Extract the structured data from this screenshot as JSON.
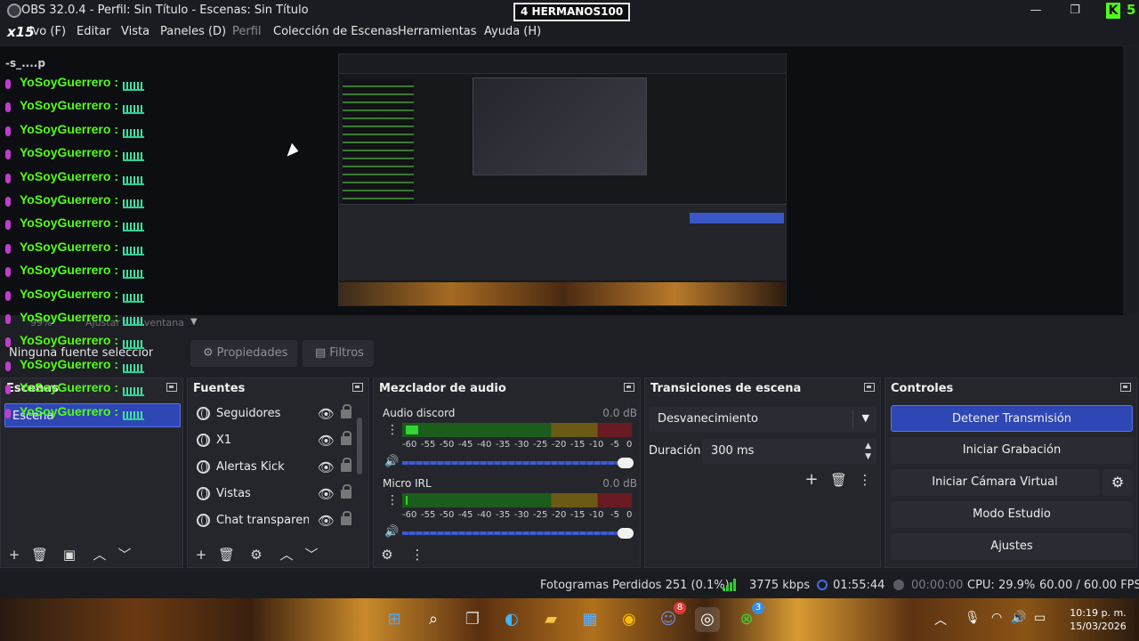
{
  "titlebar": {
    "title": "OBS 32.0.4 - Perfil: Sin Título - Escenas: Sin Título",
    "overlay_banner": "4  HERMANOS100",
    "minimize": "—",
    "maximize": "❐",
    "close": "✕",
    "kick_letter": "K",
    "kick_count": "5"
  },
  "menu": {
    "logo_text": "x15",
    "items": [
      {
        "label": "Archivo (F)",
        "shown": "ivo (F)"
      },
      {
        "label": "Editar"
      },
      {
        "label": "Vista"
      },
      {
        "label": "Paneles (D)"
      },
      {
        "label": "Perfil",
        "disabled": true
      },
      {
        "label": "Colección de Escenas"
      },
      {
        "label": "Herramientas"
      },
      {
        "label": "Ayuda (H)"
      }
    ]
  },
  "chat": {
    "partial_top": "-s_....p",
    "username": "YoSoyGuerrero",
    "separator": ":",
    "rows": 15
  },
  "zoom": {
    "value": "99%",
    "mode": "Ajustar a la ventana"
  },
  "context": {
    "no_selection": "Ninguna fuente seleccionada",
    "properties_label": "Propiedades",
    "filters_label": "Filtros"
  },
  "scenes": {
    "title": "Escenas",
    "items": [
      {
        "label": "Escena"
      }
    ]
  },
  "sources": {
    "title": "Fuentes",
    "items": [
      {
        "label": "Seguidores"
      },
      {
        "label": "X1"
      },
      {
        "label": "Alertas Kick"
      },
      {
        "label": "Vistas"
      },
      {
        "label": "Chat transparente"
      }
    ]
  },
  "mixer": {
    "title": "Mezclador de audio",
    "channels": [
      {
        "name": "Audio discord",
        "db": "0.0 dB"
      },
      {
        "name": "Micro IRL",
        "db": "0.0 dB"
      }
    ],
    "scale": [
      "-60",
      "-55",
      "-50",
      "-45",
      "-40",
      "-35",
      "-30",
      "-25",
      "-20",
      "-15",
      "-10",
      "-5",
      "0"
    ]
  },
  "transitions": {
    "title": "Transiciones de escena",
    "selected": "Desvanecimiento",
    "duration_label": "Duración",
    "duration_value": "300 ms"
  },
  "controls": {
    "title": "Controles",
    "stop_stream": "Detener Transmisión",
    "start_recording": "Iniciar Grabación",
    "start_virtual_cam": "Iniciar Cámara Virtual",
    "studio_mode": "Modo Estudio",
    "settings": "Ajustes"
  },
  "status": {
    "dropped_frames": "Fotogramas Perdidos 251 (0.1%)",
    "bitrate": "3775 kbps",
    "stream_time": "01:55:44",
    "rec_time": "00:00:00",
    "cpu": "CPU: 29.9%",
    "fps": "60.00 / 60.00 FPS"
  },
  "taskbar": {
    "discord_badge": "8",
    "xbox_badge": "3",
    "time": "10:19 p. m.",
    "date": "15/03/2026"
  },
  "colors": {
    "accent": "#2e47b4",
    "kick_green": "#53fc18",
    "background": "#1e1f24",
    "dock": "#25262c"
  }
}
